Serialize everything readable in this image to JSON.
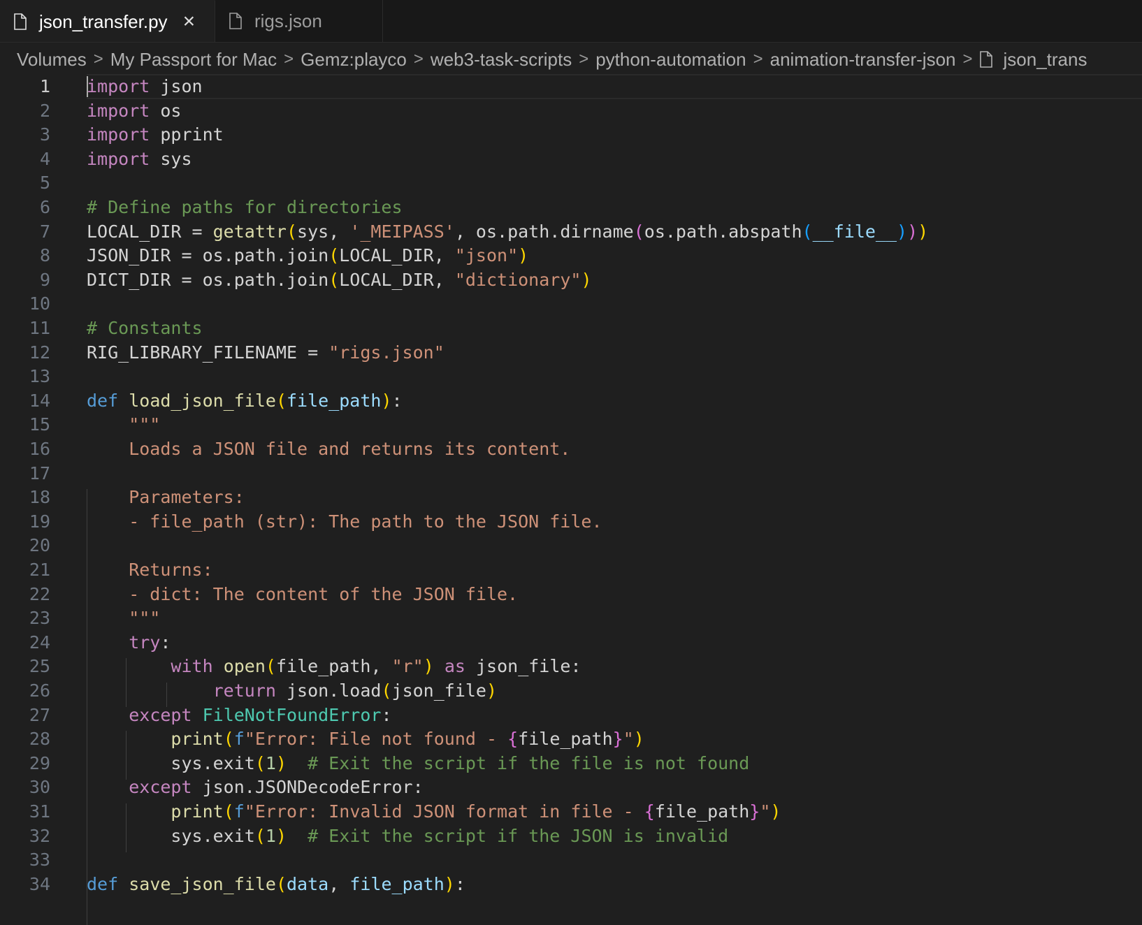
{
  "tabs": [
    {
      "label": "json_transfer.py",
      "active": true,
      "close_glyph": "×",
      "icon": "file-icon"
    },
    {
      "label": "rigs.json",
      "active": false,
      "icon": "file-icon"
    }
  ],
  "breadcrumb": {
    "separator": ">",
    "items": [
      "Volumes",
      "My Passport for Mac",
      "Gemz:playco",
      "web3-task-scripts",
      "python-automation",
      "animation-transfer-json",
      "json_trans"
    ]
  },
  "colors": {
    "background": "#1f1f1f",
    "keyword": "#c586c0",
    "def": "#569cd6",
    "function": "#dcdcaa",
    "param": "#9cdcfe",
    "string": "#ce9178",
    "comment": "#6a9955",
    "number": "#b5cea8",
    "class": "#4ec9b0"
  },
  "editor": {
    "current_line": 1,
    "lines": [
      [
        [
          "kw",
          "import"
        ],
        [
          "plain",
          " json"
        ]
      ],
      [
        [
          "kw",
          "import"
        ],
        [
          "plain",
          " os"
        ]
      ],
      [
        [
          "kw",
          "import"
        ],
        [
          "plain",
          " pprint"
        ]
      ],
      [
        [
          "kw",
          "import"
        ],
        [
          "plain",
          " sys"
        ]
      ],
      [],
      [
        [
          "cm",
          "# Define paths for directories"
        ]
      ],
      [
        [
          "plain",
          "LOCAL_DIR = "
        ],
        [
          "fn",
          "getattr"
        ],
        [
          "b1",
          "("
        ],
        [
          "plain",
          "sys, "
        ],
        [
          "str",
          "'_MEIPASS'"
        ],
        [
          "plain",
          ", os.path.dirname"
        ],
        [
          "b2",
          "("
        ],
        [
          "plain",
          "os.path.abspath"
        ],
        [
          "b3",
          "("
        ],
        [
          "var",
          "__file__"
        ],
        [
          "b3",
          ")"
        ],
        [
          "b2",
          ")"
        ],
        [
          "b1",
          ")"
        ]
      ],
      [
        [
          "plain",
          "JSON_DIR = os.path.join"
        ],
        [
          "b1",
          "("
        ],
        [
          "plain",
          "LOCAL_DIR, "
        ],
        [
          "str",
          "\"json\""
        ],
        [
          "b1",
          ")"
        ]
      ],
      [
        [
          "plain",
          "DICT_DIR = os.path.join"
        ],
        [
          "b1",
          "("
        ],
        [
          "plain",
          "LOCAL_DIR, "
        ],
        [
          "str",
          "\"dictionary\""
        ],
        [
          "b1",
          ")"
        ]
      ],
      [],
      [
        [
          "cm",
          "# Constants"
        ]
      ],
      [
        [
          "plain",
          "RIG_LIBRARY_FILENAME = "
        ],
        [
          "str",
          "\"rigs.json\""
        ]
      ],
      [],
      [
        [
          "def",
          "def"
        ],
        [
          "plain",
          " "
        ],
        [
          "fn",
          "load_json_file"
        ],
        [
          "b1",
          "("
        ],
        [
          "param",
          "file_path"
        ],
        [
          "b1",
          ")"
        ],
        [
          "plain",
          ":"
        ]
      ],
      [
        [
          "str",
          "    \"\"\""
        ]
      ],
      [
        [
          "str",
          "    Loads a JSON file and returns its content."
        ]
      ],
      [],
      [
        [
          "str",
          "    Parameters:"
        ]
      ],
      [
        [
          "str",
          "    - file_path (str): The path to the JSON file."
        ]
      ],
      [],
      [
        [
          "str",
          "    Returns:"
        ]
      ],
      [
        [
          "str",
          "    - dict: The content of the JSON file."
        ]
      ],
      [
        [
          "str",
          "    \"\"\""
        ]
      ],
      [
        [
          "plain",
          "    "
        ],
        [
          "kw",
          "try"
        ],
        [
          "plain",
          ":"
        ]
      ],
      [
        [
          "plain",
          "        "
        ],
        [
          "kw",
          "with"
        ],
        [
          "plain",
          " "
        ],
        [
          "fn",
          "open"
        ],
        [
          "b1",
          "("
        ],
        [
          "plain",
          "file_path, "
        ],
        [
          "str",
          "\"r\""
        ],
        [
          "b1",
          ")"
        ],
        [
          "plain",
          " "
        ],
        [
          "kw",
          "as"
        ],
        [
          "plain",
          " json_file:"
        ]
      ],
      [
        [
          "plain",
          "            "
        ],
        [
          "kw",
          "return"
        ],
        [
          "plain",
          " json.load"
        ],
        [
          "b1",
          "("
        ],
        [
          "plain",
          "json_file"
        ],
        [
          "b1",
          ")"
        ]
      ],
      [
        [
          "plain",
          "    "
        ],
        [
          "kw",
          "except"
        ],
        [
          "plain",
          " "
        ],
        [
          "cls",
          "FileNotFoundError"
        ],
        [
          "plain",
          ":"
        ]
      ],
      [
        [
          "plain",
          "        "
        ],
        [
          "fn",
          "print"
        ],
        [
          "b1",
          "("
        ],
        [
          "def",
          "f"
        ],
        [
          "str",
          "\"Error: File not found - "
        ],
        [
          "b2",
          "{"
        ],
        [
          "plain",
          "file_path"
        ],
        [
          "b2",
          "}"
        ],
        [
          "str",
          "\""
        ],
        [
          "b1",
          ")"
        ]
      ],
      [
        [
          "plain",
          "        sys.exit"
        ],
        [
          "b1",
          "("
        ],
        [
          "num",
          "1"
        ],
        [
          "b1",
          ")"
        ],
        [
          "plain",
          "  "
        ],
        [
          "cm",
          "# Exit the script if the file is not found"
        ]
      ],
      [
        [
          "plain",
          "    "
        ],
        [
          "kw",
          "except"
        ],
        [
          "plain",
          " json.JSONDecodeError:"
        ]
      ],
      [
        [
          "plain",
          "        "
        ],
        [
          "fn",
          "print"
        ],
        [
          "b1",
          "("
        ],
        [
          "def",
          "f"
        ],
        [
          "str",
          "\"Error: Invalid JSON format in file - "
        ],
        [
          "b2",
          "{"
        ],
        [
          "plain",
          "file_path"
        ],
        [
          "b2",
          "}"
        ],
        [
          "str",
          "\""
        ],
        [
          "b1",
          ")"
        ]
      ],
      [
        [
          "plain",
          "        sys.exit"
        ],
        [
          "b1",
          "("
        ],
        [
          "num",
          "1"
        ],
        [
          "b1",
          ")"
        ],
        [
          "plain",
          "  "
        ],
        [
          "cm",
          "# Exit the script if the JSON is invalid"
        ]
      ],
      [],
      [
        [
          "def",
          "def"
        ],
        [
          "plain",
          " "
        ],
        [
          "fn",
          "save_json_file"
        ],
        [
          "b1",
          "("
        ],
        [
          "param",
          "data"
        ],
        [
          "plain",
          ", "
        ],
        [
          "param",
          "file_path"
        ],
        [
          "b1",
          ")"
        ],
        [
          "plain",
          ":"
        ]
      ]
    ]
  }
}
